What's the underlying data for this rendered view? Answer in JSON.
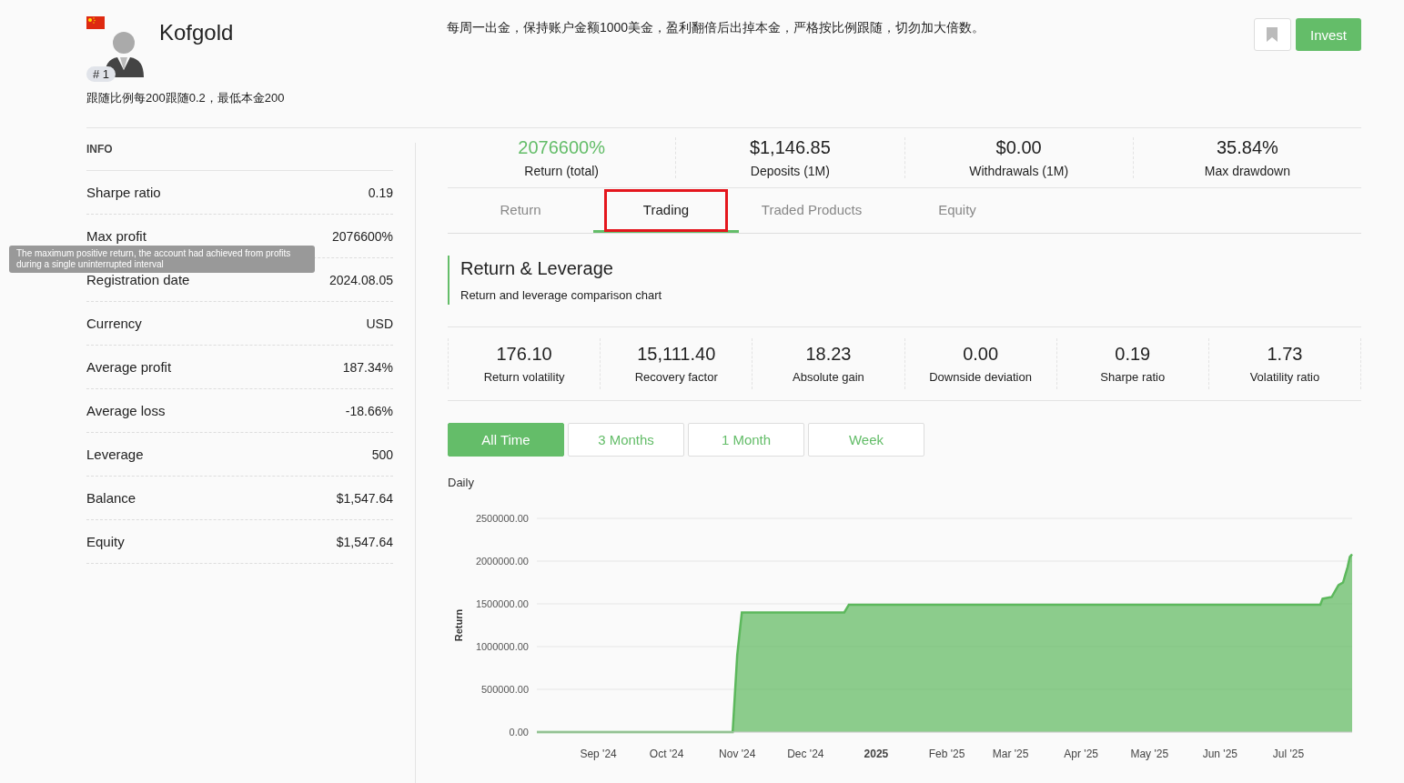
{
  "header": {
    "name": "Kofgold",
    "rank": "# 1",
    "subtitle": "跟随比例每200跟随0.2，最低本金200",
    "description": "每周一出金，保持账户金额1000美金，盈利翻倍后出掉本金，严格按比例跟随，切勿加大倍数。",
    "invest_button": "Invest"
  },
  "info": {
    "title": "INFO",
    "rows": [
      {
        "label": "Sharpe ratio",
        "value": "0.19"
      },
      {
        "label": "Max profit",
        "value": "2076600%"
      },
      {
        "label": "Registration date",
        "value": "2024.08.05"
      },
      {
        "label": "Currency",
        "value": "USD"
      },
      {
        "label": "Average profit",
        "value": "187.34%"
      },
      {
        "label": "Average loss",
        "value": "-18.66%"
      },
      {
        "label": "Leverage",
        "value": "500"
      },
      {
        "label": "Balance",
        "value": "$1,547.64"
      },
      {
        "label": "Equity",
        "value": "$1,547.64"
      }
    ]
  },
  "tooltip": {
    "text": "The maximum positive return, the account had achieved from profits during a single uninterrupted interval"
  },
  "stats": [
    {
      "value": "2076600%",
      "label": "Return (total)",
      "kind": "gain"
    },
    {
      "value": "$1,146.85",
      "label": "Deposits (1M)",
      "kind": "plain"
    },
    {
      "value": "$0.00",
      "label": "Withdrawals (1M)",
      "kind": "plain"
    },
    {
      "value": "35.84%",
      "label": "Max drawdown",
      "kind": "plain"
    }
  ],
  "tabs": [
    {
      "label": "Return",
      "selected": false,
      "highlighted": false
    },
    {
      "label": "Trading",
      "selected": true,
      "highlighted": true
    },
    {
      "label": "Traded Products",
      "selected": false,
      "highlighted": false
    },
    {
      "label": "Equity",
      "selected": false,
      "highlighted": false
    }
  ],
  "section": {
    "title": "Return & Leverage",
    "subtitle": "Return and leverage comparison chart"
  },
  "metrics": [
    {
      "value": "176.10",
      "label": "Return volatility"
    },
    {
      "value": "15,111.40",
      "label": "Recovery factor"
    },
    {
      "value": "18.23",
      "label": "Absolute gain"
    },
    {
      "value": "0.00",
      "label": "Downside deviation"
    },
    {
      "value": "0.19",
      "label": "Sharpe ratio"
    },
    {
      "value": "1.73",
      "label": "Volatility ratio"
    }
  ],
  "ranges": [
    {
      "label": "All Time",
      "selected": true
    },
    {
      "label": "3 Months",
      "selected": false
    },
    {
      "label": "1 Month",
      "selected": false
    },
    {
      "label": "Week",
      "selected": false
    }
  ],
  "chart_data": {
    "type": "area",
    "title": "Daily",
    "ylabel": "Return",
    "x": [
      "2024-08-05",
      "2024-10-30",
      "2024-11-01",
      "2024-11-03",
      "2024-12-18",
      "2024-12-20",
      "2025-07-15",
      "2025-07-16",
      "2025-07-20",
      "2025-07-23",
      "2025-07-25",
      "2025-07-27",
      "2025-07-28",
      "2025-07-29"
    ],
    "series": [
      {
        "color": "#5cb85c",
        "values": [
          0,
          0,
          900000,
          1400000,
          1400000,
          1490000,
          1490000,
          1560000,
          1580000,
          1720000,
          1750000,
          1930000,
          2050000,
          2080000
        ]
      }
    ],
    "grid": true,
    "xlim": [
      "2024-08-05",
      "2025-07-29"
    ],
    "ylim": [
      0,
      2500000
    ],
    "xticks": [
      {
        "value": "2024-09-01",
        "label": "Sep '24"
      },
      {
        "value": "2024-10-01",
        "label": "Oct '24"
      },
      {
        "value": "2024-11-01",
        "label": "Nov '24"
      },
      {
        "value": "2024-12-01",
        "label": "Dec '24"
      },
      {
        "value": "2025-01-01",
        "label": "2025"
      },
      {
        "value": "2025-02-01",
        "label": "Feb '25"
      },
      {
        "value": "2025-03-01",
        "label": "Mar '25"
      },
      {
        "value": "2025-04-01",
        "label": "Apr '25"
      },
      {
        "value": "2025-05-01",
        "label": "May '25"
      },
      {
        "value": "2025-06-01",
        "label": "Jun '25"
      },
      {
        "value": "2025-07-01",
        "label": "Jul '25"
      }
    ],
    "yticks": [
      {
        "value": 0,
        "label": "0.00"
      },
      {
        "value": 500000,
        "label": "500000.00"
      },
      {
        "value": 1000000,
        "label": "1000000.00"
      },
      {
        "value": 1500000,
        "label": "1500000.00"
      },
      {
        "value": 2000000,
        "label": "2000000.00"
      },
      {
        "value": 2500000,
        "label": "2500000.00"
      }
    ]
  }
}
